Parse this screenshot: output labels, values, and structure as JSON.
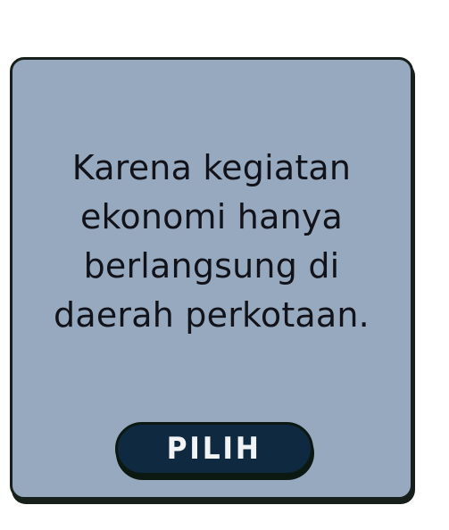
{
  "card": {
    "answer_text": "Karena kegiatan ekonomi hanya berlangsung di daerah perkotaan.",
    "button_label": "PILIH"
  },
  "colors": {
    "card_background": "#97a9be",
    "card_border": "#161f1a",
    "button_background": "#0f2940",
    "button_text": "#f1f3f4"
  }
}
